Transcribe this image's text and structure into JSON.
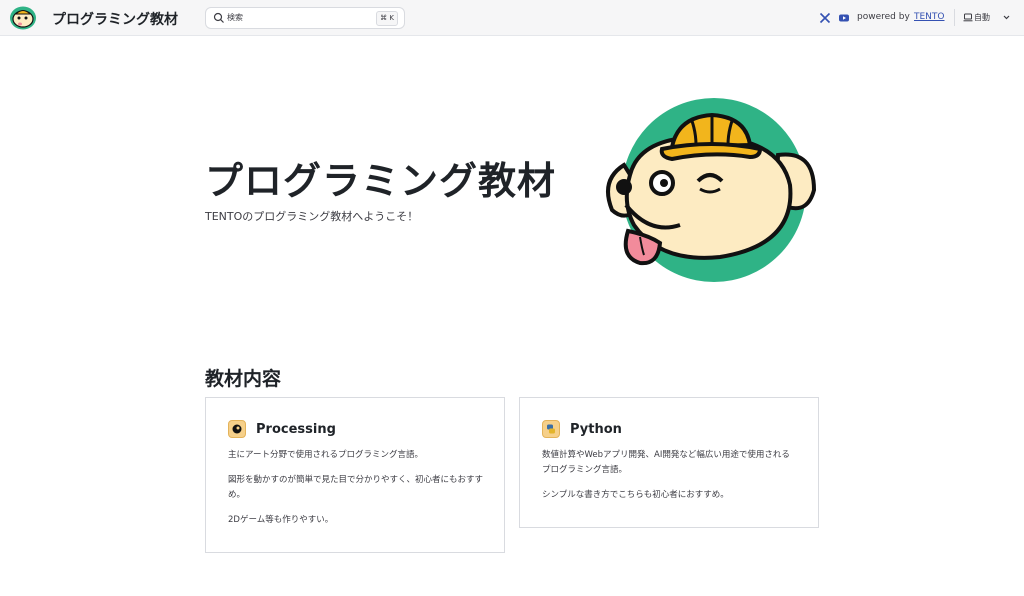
{
  "header": {
    "site_title": "プログラミング教材",
    "search": {
      "label": "検索",
      "shortcut": "⌘ K"
    },
    "social_icons": [
      "x-icon",
      "youtube-icon"
    ],
    "powered_by": "powered by",
    "powered_link": "TENTO",
    "appearance": "自動"
  },
  "hero": {
    "title": "プログラミング教材",
    "tagline": "TENTOのプログラミング教材へようこそ！"
  },
  "section": {
    "title": "教材内容",
    "cards": [
      {
        "title": "Processing",
        "icon": "processing-icon",
        "paragraphs": [
          "主にアート分野で使用されるプログラミング言語。",
          "図形を動かすのが簡単で見た目で分かりやすく、初心者にもおすすめ。",
          "2Dゲーム等も作りやすい。"
        ]
      },
      {
        "title": "Python",
        "icon": "python-icon",
        "paragraphs": [
          "数値計算やWebアプリ開発、AI開発など幅広い用途で使用されるプログラミング言語。",
          "シンプルな書き方でこちらも初心者におすすめ。"
        ]
      }
    ]
  },
  "colors": {
    "accent": "#3451b2",
    "mascot_bg": "#2fb386",
    "helmet": "#f2b51c",
    "card_icon": "#f6d08a"
  }
}
